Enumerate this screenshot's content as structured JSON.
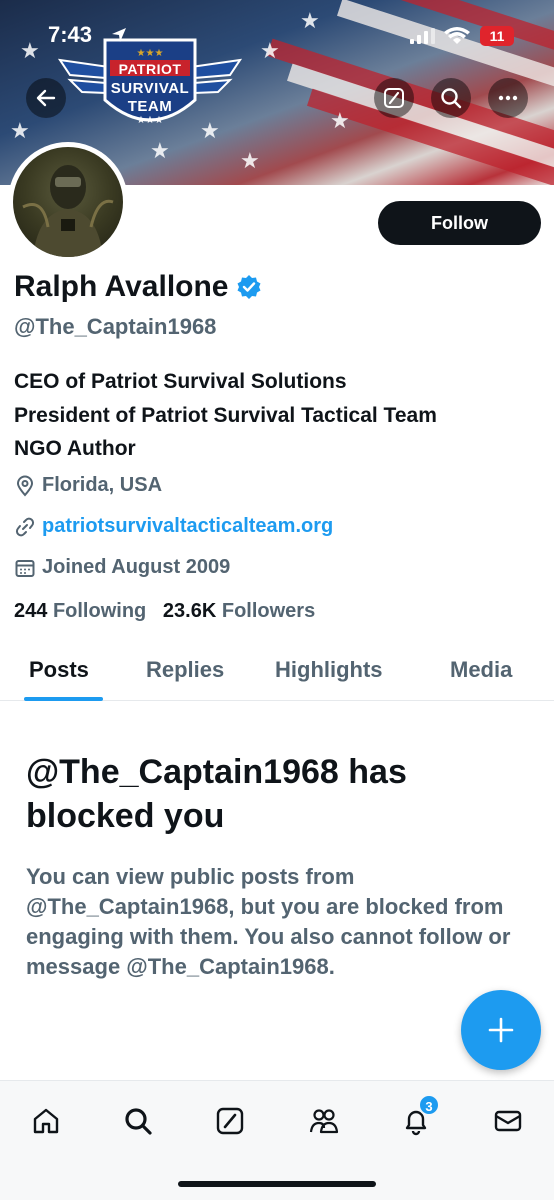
{
  "status_bar": {
    "time": "7:43",
    "battery": "11"
  },
  "banner": {
    "logo_line1": "PATRIOT",
    "logo_line2": "SURVIVAL",
    "logo_line3": "TEAM"
  },
  "profile": {
    "follow_label": "Follow",
    "name": "Ralph Avallone",
    "handle": "@The_Captain1968",
    "bio_lines": [
      "CEO of Patriot Survival Solutions",
      "President of Patriot Survival Tactical Team",
      "NGO Author"
    ],
    "location": "Florida, USA",
    "website": "patriotsurvivaltacticalteam.org",
    "joined": "Joined August 2009",
    "following_count": "244",
    "following_label": "Following",
    "followers_count": "23.6K",
    "followers_label": "Followers"
  },
  "tabs": [
    {
      "label": "Posts",
      "active": true
    },
    {
      "label": "Replies",
      "active": false
    },
    {
      "label": "Highlights",
      "active": false
    },
    {
      "label": "Media",
      "active": false
    }
  ],
  "blocked": {
    "title": "@The_Captain1968 has blocked you",
    "body": "You can view public posts from @The_Captain1968, but you are blocked from engaging with them. You also cannot follow or message @The_Captain1968."
  },
  "bottom_nav": {
    "items": [
      "home-icon",
      "search-icon",
      "grok-icon",
      "communities-icon",
      "notifications-icon",
      "messages-icon"
    ],
    "notification_badge": "3"
  },
  "colors": {
    "accent": "#1d9bf0",
    "text": "#0f1419",
    "muted": "#536471"
  }
}
